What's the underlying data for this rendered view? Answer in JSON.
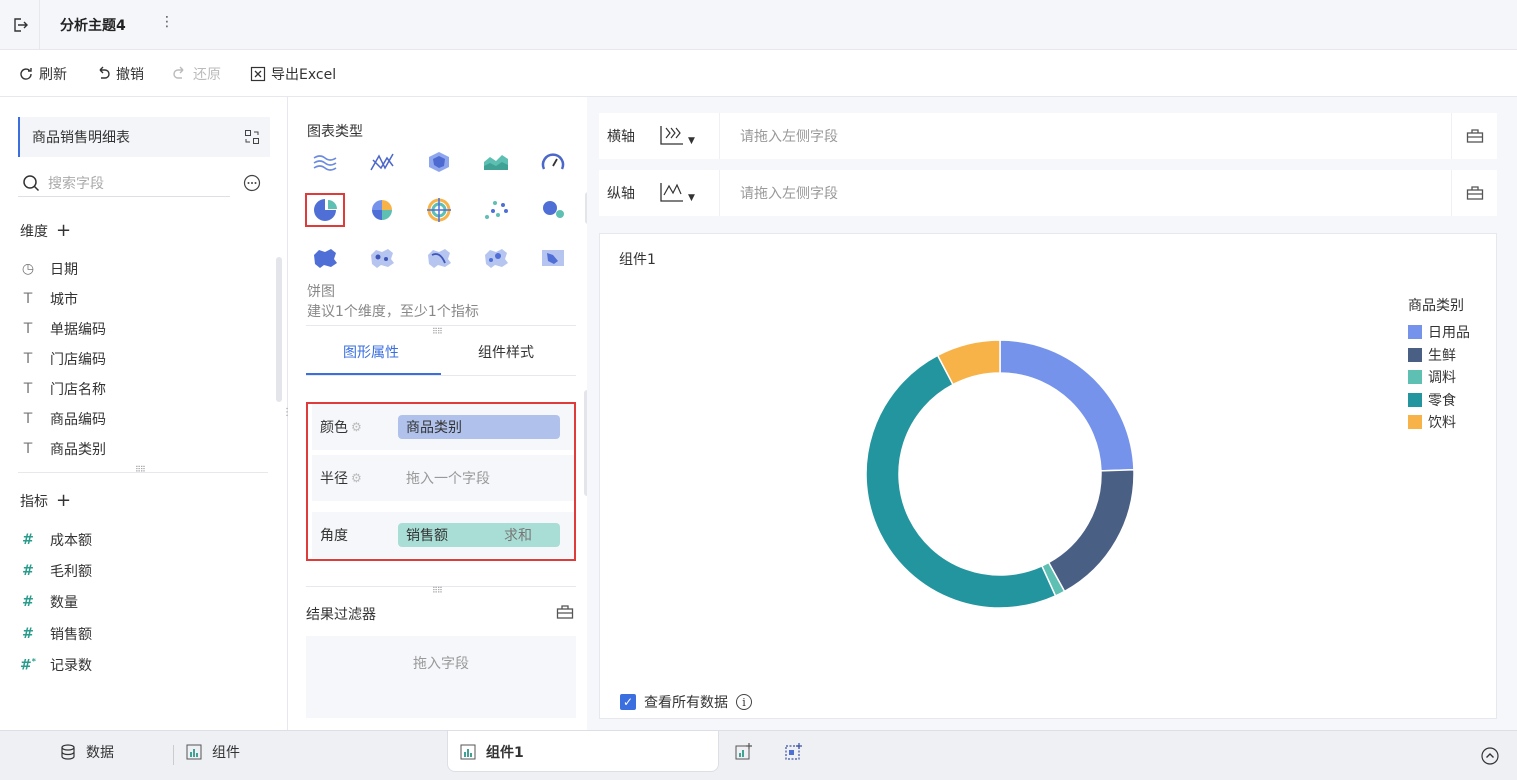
{
  "header": {
    "title": "分析主题4"
  },
  "toolbar": {
    "refresh": "刷新",
    "undo": "撤销",
    "redo": "还原",
    "export": "导出Excel"
  },
  "left_panel": {
    "dataset_name": "商品销售明细表",
    "search_placeholder": "搜索字段",
    "dimensions_title": "维度",
    "dimensions": [
      "日期",
      "城市",
      "单据编码",
      "门店编码",
      "门店名称",
      "商品编码",
      "商品类别"
    ],
    "measures_title": "指标",
    "measures": [
      "成本额",
      "毛利额",
      "数量",
      "销售额",
      "记录数"
    ]
  },
  "middle_panel": {
    "chart_type_title": "图表类型",
    "selected_chart_name": "饼图",
    "selected_chart_hint": "建议1个维度，至少1个指标",
    "tabs": [
      "图形属性",
      "组件样式"
    ],
    "properties": {
      "color_label": "颜色",
      "color_field": "商品类别",
      "radius_label": "半径",
      "radius_placeholder": "拖入一个字段",
      "angle_label": "角度",
      "angle_field": "销售额",
      "angle_agg": "求和"
    },
    "filter_title": "结果过滤器",
    "filter_placeholder": "拖入字段"
  },
  "right_panel": {
    "x_axis_label": "横轴",
    "y_axis_label": "纵轴",
    "axis_placeholder": "请拖入左侧字段",
    "component_title": "组件1",
    "view_all_label": "查看所有数据"
  },
  "bottom_tabs": {
    "data": "数据",
    "component": "组件",
    "active": "组件1"
  },
  "chart_data": {
    "type": "pie",
    "legend_title": "商品类别",
    "legend_position": "right",
    "categories": [
      "日用品",
      "生鲜",
      "调料",
      "零食",
      "饮料"
    ],
    "values": [
      24.5,
      17.5,
      1.2,
      49.1,
      7.7
    ],
    "colors": [
      "#7693ec",
      "#4a5f84",
      "#5ebfb3",
      "#23959e",
      "#f7b248"
    ]
  }
}
